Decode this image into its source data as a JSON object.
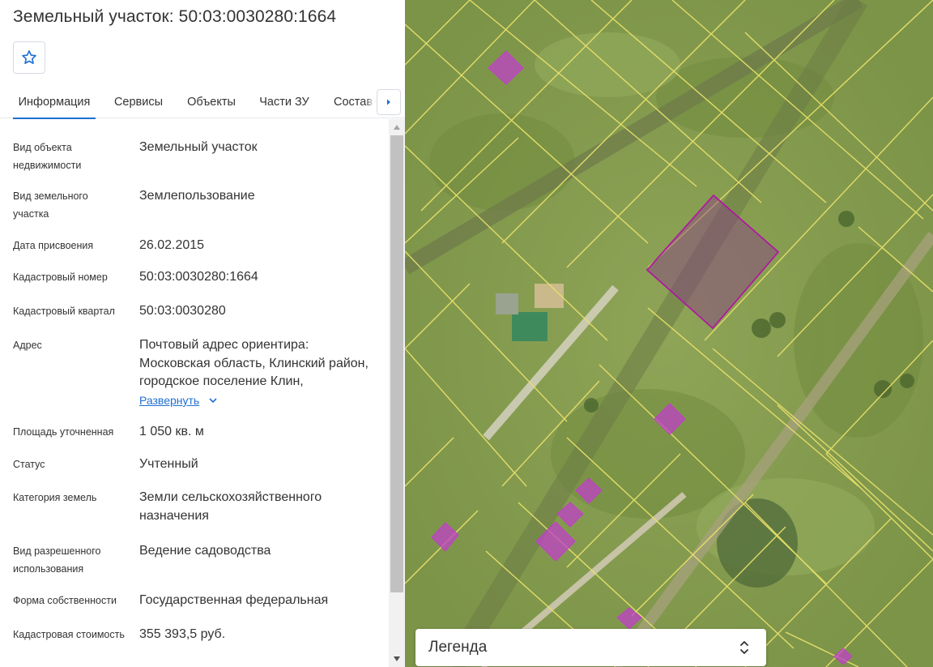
{
  "panel": {
    "title": "Земельный участок: 50:03:0030280:1664",
    "tabs": [
      {
        "label": "Информация",
        "active": true
      },
      {
        "label": "Сервисы",
        "active": false
      },
      {
        "label": "Объекты",
        "active": false
      },
      {
        "label": "Части ЗУ",
        "active": false
      },
      {
        "label": "Состав",
        "active": false
      }
    ],
    "fields": [
      {
        "label": "Вид объекта недвижимости",
        "value": "Земельный участок"
      },
      {
        "label": "Вид земельного участка",
        "value": "Землепользование"
      },
      {
        "label": "Дата присвоения",
        "value": "26.02.2015"
      },
      {
        "label": "Кадастровый номер",
        "value": "50:03:0030280:1664"
      },
      {
        "label": "Кадастровый квартал",
        "value": "50:03:0030280"
      },
      {
        "label": "Адрес",
        "value": "Почтовый адрес ориентира: Московская область, Клинский район, городское поселение Клин,",
        "expand_label": "Развернуть"
      },
      {
        "label": "Площадь уточненная",
        "value": "1 050 кв. м"
      },
      {
        "label": "Статус",
        "value": "Учтенный"
      },
      {
        "label": "Категория земель",
        "value": "Земли сельскохозяйственного назначения"
      },
      {
        "label": "Вид разрешенного использования",
        "value": "Ведение садоводства"
      },
      {
        "label": "Форма собственности",
        "value": "Государственная федеральная"
      },
      {
        "label": "Кадастровая стоимость",
        "value": "355 393,5 руб."
      }
    ]
  },
  "map": {
    "legend_label": "Легенда"
  },
  "colors": {
    "accent": "#1f6fd1",
    "parcel_line": "#e6e070",
    "selected_parcel": "#b0199f",
    "building": "#c040c8"
  },
  "icons": {
    "favorite": "star-outline-icon",
    "tabs_next": "chevron-right-icon",
    "expand": "chevron-down-icon",
    "legend_toggle": "unfold-icon"
  }
}
